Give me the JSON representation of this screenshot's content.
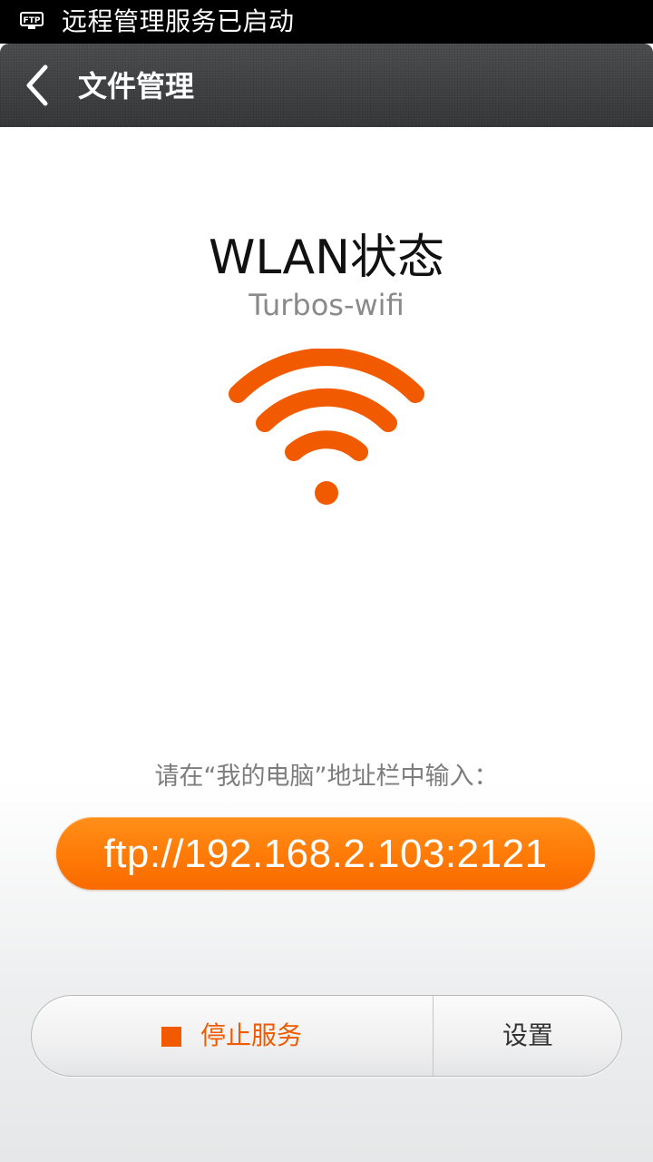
{
  "status_bar": {
    "notification_icon": "ftp-icon",
    "notification_icon_text": "FTP",
    "text": "远程管理服务已启动"
  },
  "title_bar": {
    "back_icon": "chevron-left-icon",
    "title": "文件管理"
  },
  "wlan": {
    "title": "WLAN状态",
    "ssid": "Turbos-wifi",
    "icon": "wifi-icon"
  },
  "instructions": {
    "hint": "请在“我的电脑”地址栏中输入：",
    "ftp_address": "ftp://192.168.2.103:2121"
  },
  "actions": {
    "stop_icon": "stop-square-icon",
    "stop_label": "停止服务",
    "settings_label": "设置"
  },
  "colors": {
    "accent": "#f25a00",
    "status_bar": "#000000",
    "title_bar": "#3a3c3e"
  }
}
